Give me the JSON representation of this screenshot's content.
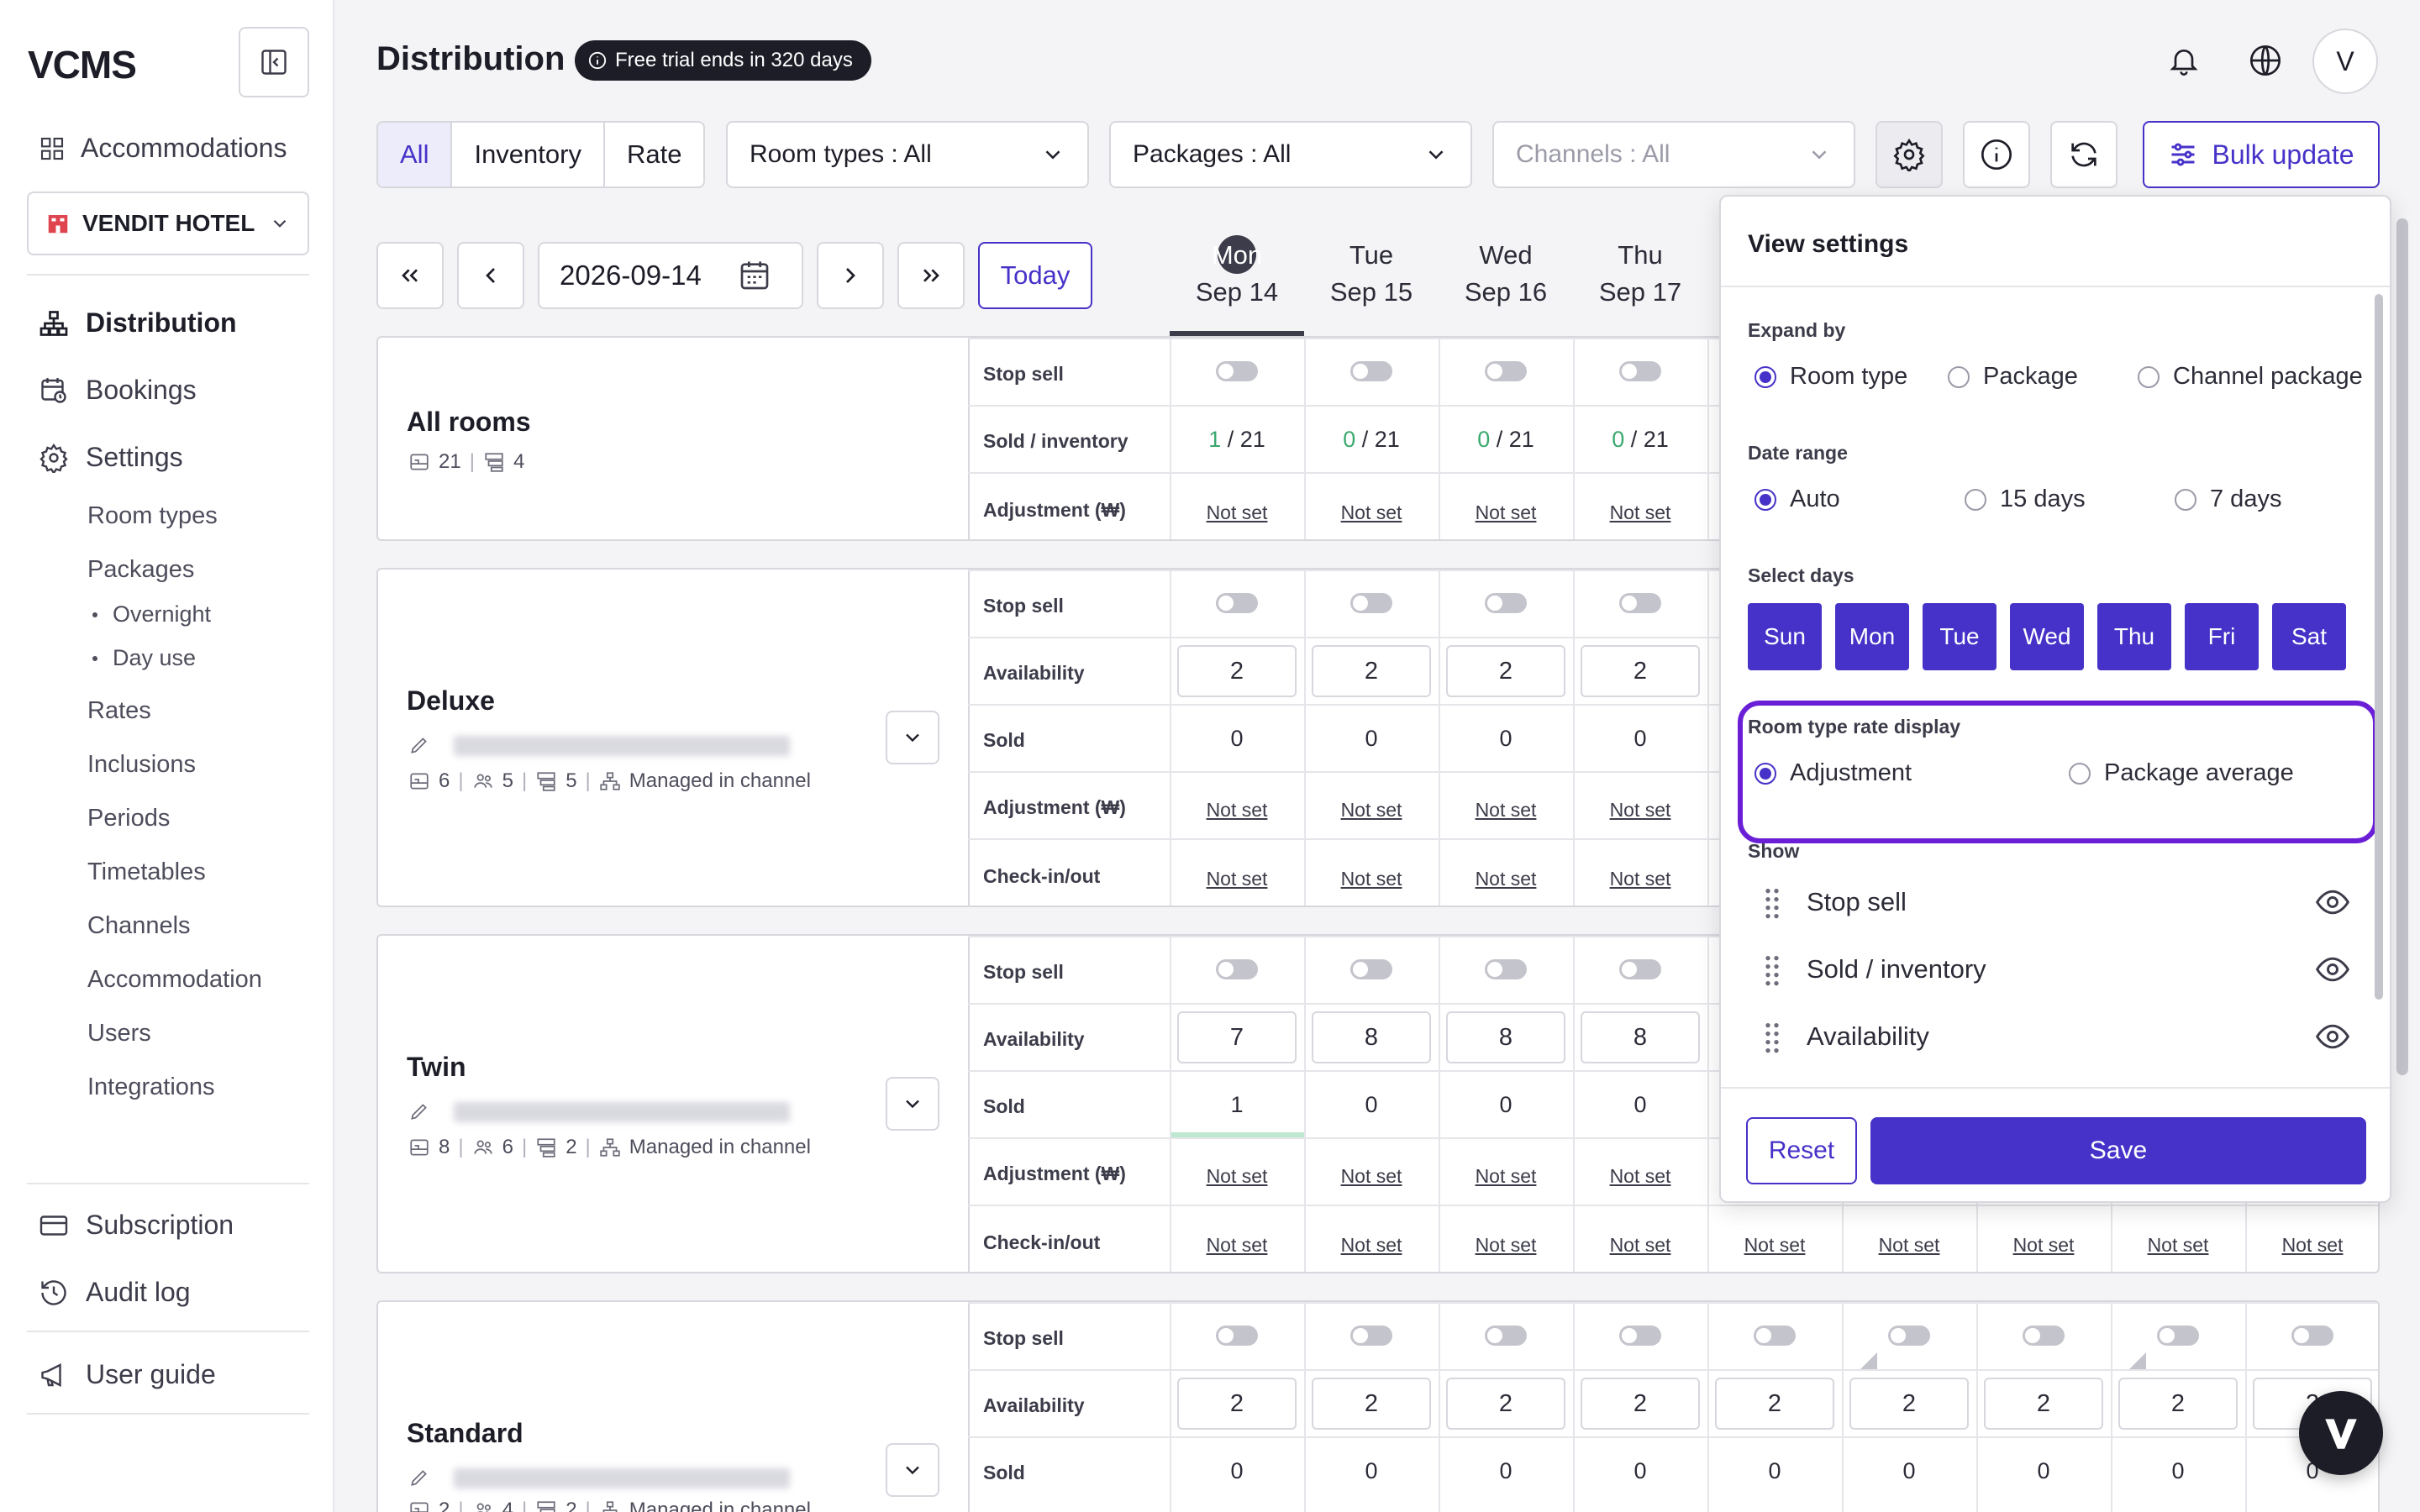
{
  "sidebar": {
    "logo": "VCMS",
    "nav_top": "Accommodations",
    "hotel": "VENDIT HOTEL",
    "items": [
      {
        "label": "Distribution",
        "icon": "sitemap-icon"
      },
      {
        "label": "Bookings",
        "icon": "calendar-clock-icon"
      },
      {
        "label": "Settings",
        "icon": "gear-icon"
      }
    ],
    "settings_sub": [
      "Room types",
      "Packages",
      "Rates",
      "Inclusions",
      "Periods",
      "Timetables",
      "Channels",
      "Accommodation",
      "Users",
      "Integrations"
    ],
    "packages_sub": [
      "Overnight",
      "Day use"
    ],
    "bottom": [
      {
        "label": "Subscription",
        "icon": "card-icon"
      },
      {
        "label": "Audit log",
        "icon": "history-icon"
      },
      {
        "label": "User guide",
        "icon": "megaphone-icon"
      }
    ]
  },
  "header": {
    "title": "Distribution",
    "trial": "Free trial ends in 320 days",
    "avatar": "V"
  },
  "toolbar": {
    "segments": [
      "All",
      "Inventory",
      "Rate"
    ],
    "room_types": "Room types : All",
    "packages": "Packages : All",
    "channels": "Channels : All",
    "bulk_update": "Bulk update"
  },
  "datenav": {
    "date": "2026-09-14",
    "today": "Today",
    "days": [
      {
        "dow": "Mon",
        "date": "Sep 14"
      },
      {
        "dow": "Tue",
        "date": "Sep 15"
      },
      {
        "dow": "Wed",
        "date": "Sep 16"
      },
      {
        "dow": "Thu",
        "date": "Sep 17"
      }
    ]
  },
  "grid": {
    "labels": {
      "stop_sell": "Stop sell",
      "sold_inventory": "Sold / inventory",
      "adjustment": "Adjustment (₩)",
      "availability": "Availability",
      "sold": "Sold",
      "check": "Check-in/out",
      "not_set": "Not set",
      "managed": "Managed in channel"
    },
    "all_rooms": {
      "name": "All rooms",
      "rooms": "21",
      "types": "4",
      "sold": [
        "1",
        "0",
        "0",
        "0"
      ],
      "inventory": [
        "21",
        "21",
        "21",
        "21"
      ]
    },
    "deluxe": {
      "name": "Deluxe",
      "m1": "6",
      "m2": "5",
      "m3": "5",
      "availability": [
        "2",
        "2",
        "2",
        "2"
      ],
      "sold": [
        "0",
        "0",
        "0",
        "0"
      ]
    },
    "twin": {
      "name": "Twin",
      "m1": "8",
      "m2": "6",
      "m3": "2",
      "availability": [
        "7",
        "8",
        "8",
        "8"
      ],
      "sold": [
        "1",
        "0",
        "0",
        "0"
      ]
    },
    "standard": {
      "name": "Standard",
      "m1": "2",
      "m2": "4",
      "m3": "2",
      "availability": [
        "2",
        "2",
        "2",
        "2",
        "2",
        "2",
        "2",
        "2",
        "2"
      ],
      "sold": [
        "0",
        "0",
        "0",
        "0",
        "0",
        "0",
        "0",
        "0",
        "0"
      ]
    }
  },
  "panel": {
    "title": "View settings",
    "expand_by": {
      "label": "Expand by",
      "options": [
        "Room type",
        "Package",
        "Channel package"
      ],
      "selected": 0
    },
    "date_range": {
      "label": "Date range",
      "options": [
        "Auto",
        "15 days",
        "7 days"
      ],
      "selected": 0
    },
    "select_days": {
      "label": "Select days",
      "days": [
        "Sun",
        "Mon",
        "Tue",
        "Wed",
        "Thu",
        "Fri",
        "Sat"
      ]
    },
    "rate_display": {
      "label": "Room type rate display",
      "options": [
        "Adjustment",
        "Package average"
      ],
      "selected": 0
    },
    "show": {
      "label": "Show",
      "items": [
        "Stop sell",
        "Sold / inventory",
        "Availability"
      ]
    },
    "reset": "Reset",
    "save": "Save"
  },
  "colors": {
    "accent": "#4632c8",
    "highlight": "#6a1fd6",
    "green": "#3aa96e"
  }
}
